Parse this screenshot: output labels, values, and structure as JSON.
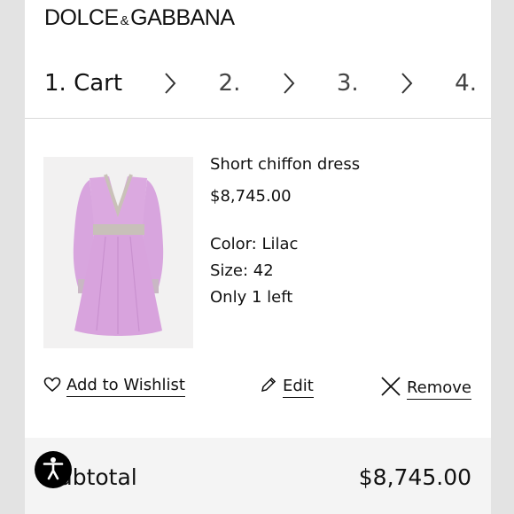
{
  "brand": {
    "name_left": "DOLCE",
    "ampersand": "&",
    "name_right": "GABBANA"
  },
  "checkout_steps": [
    {
      "label": "1. Cart",
      "active": true
    },
    {
      "label": "2.",
      "active": false
    },
    {
      "label": "3.",
      "active": false
    },
    {
      "label": "4.",
      "active": false
    }
  ],
  "cart_item": {
    "name": "Short chiffon dress",
    "price": "$8,745.00",
    "color": "Color: Lilac",
    "size": "Size: 42",
    "stock": "Only 1 left",
    "image_icon": "dress-image"
  },
  "item_actions": {
    "wishlist_label": "Add to Wishlist",
    "edit_label": "Edit",
    "remove_label": "Remove"
  },
  "summary": {
    "subtotal_label": "Subtotal",
    "subtotal_value": "$8,745.00"
  },
  "accessibility": {
    "icon": "accessibility-icon"
  },
  "colors": {
    "dress": "#d9a8df",
    "background": "#ffffff",
    "subtotal_bg": "#f4f4f4",
    "text": "#111111"
  }
}
